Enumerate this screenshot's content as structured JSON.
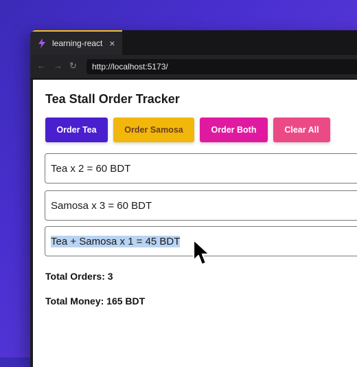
{
  "browser": {
    "tab_title": "learning-react",
    "tab_close": "×",
    "url": "http://localhost:5173/",
    "nav": {
      "back": "←",
      "forward": "→",
      "reload": "↻"
    }
  },
  "app": {
    "title": "Tea Stall Order Tracker",
    "buttons": [
      {
        "label": "Order Tea",
        "color": "#4a1fd0",
        "text_color": "#ffffff"
      },
      {
        "label": "Order Samosa",
        "color": "#f2b70b",
        "text_color": "#6b3d1f"
      },
      {
        "label": "Order Both",
        "color": "#e01aa0",
        "text_color": "#ffffff"
      },
      {
        "label": "Clear All",
        "color": "#ec4a86",
        "text_color": "#ffffff"
      }
    ],
    "orders": [
      {
        "text": "Tea x 2 = 60 BDT"
      },
      {
        "text": "Samosa x 3 = 60 BDT"
      },
      {
        "text": "Tea + Samosa x 1 = 45 BDT",
        "selected": true
      }
    ],
    "total_orders": "Total Orders: 3",
    "total_money": "Total Money: 165 BDT"
  }
}
